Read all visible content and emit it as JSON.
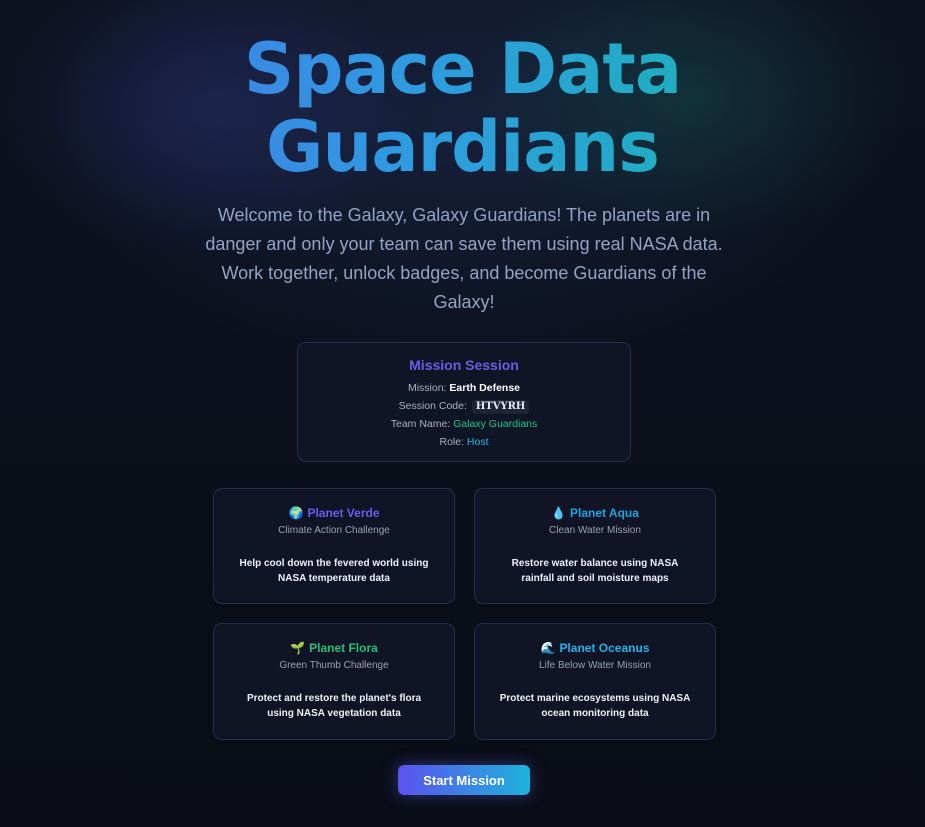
{
  "title": {
    "line1": "Space Data",
    "line2": "Guardians"
  },
  "intro": "Welcome to the Galaxy, Galaxy Guardians! The planets are in danger and only your team can save them using real NASA data. Work together, unlock badges, and become Guardians of the Galaxy!",
  "session": {
    "heading": "Mission Session",
    "mission_label": "Mission:",
    "mission_value": "Earth Defense",
    "code_label": "Session Code:",
    "code_value": "HTVYRH",
    "team_label": "Team Name:",
    "team_value": "Galaxy Guardians",
    "role_label": "Role:",
    "role_value": "Host"
  },
  "planets": [
    {
      "icon": "🌍",
      "icon_name": "globe-icon",
      "name": "Planet Verde",
      "subtitle": "Climate Action Challenge",
      "description": "Help cool down the fevered world using NASA temperature data",
      "color": "#6a5cf0"
    },
    {
      "icon": "💧",
      "icon_name": "droplet-icon",
      "name": "Planet Aqua",
      "subtitle": "Clean Water Mission",
      "description": "Restore water balance using NASA rainfall and soil moisture maps",
      "color": "#1fa3e0"
    },
    {
      "icon": "🌱",
      "icon_name": "seedling-icon",
      "name": "Planet Flora",
      "subtitle": "Green Thumb Challenge",
      "description": "Protect and restore the planet's flora using NASA vegetation data",
      "color": "#22c07a"
    },
    {
      "icon": "🌊",
      "icon_name": "wave-icon",
      "name": "Planet Oceanus",
      "subtitle": "Life Below Water Mission",
      "description": "Protect marine ecosystems using NASA ocean monitoring data",
      "color": "#22b2ea"
    }
  ],
  "start_button": "Start Mission"
}
